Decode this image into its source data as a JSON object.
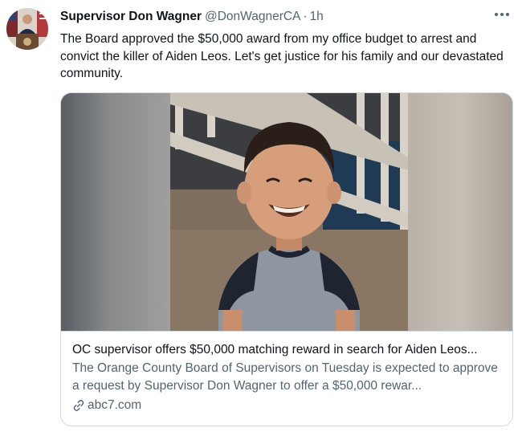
{
  "author": {
    "display_name": "Supervisor Don Wagner",
    "handle": "@DonWagnerCA",
    "separator": "·",
    "time": "1h"
  },
  "tweet": {
    "text": "The Board approved the $50,000 award from my office budget to arrest and convict the killer of Aiden Leos. Let's get justice for his family and our devastated community."
  },
  "card": {
    "title": "OC supervisor offers $50,000 matching reward in search for Aiden Leos...",
    "description": "The Orange County Board of Supervisors on Tuesday is expected to approve a request by Supervisor Don Wagner to offer a $50,000 rewar...",
    "domain": "abc7.com"
  },
  "icons": {
    "more": "more-horizontal-icon",
    "link": "link-icon"
  },
  "colors": {
    "text_primary": "#0f1419",
    "text_secondary": "#536471",
    "border": "#cfd9de"
  }
}
